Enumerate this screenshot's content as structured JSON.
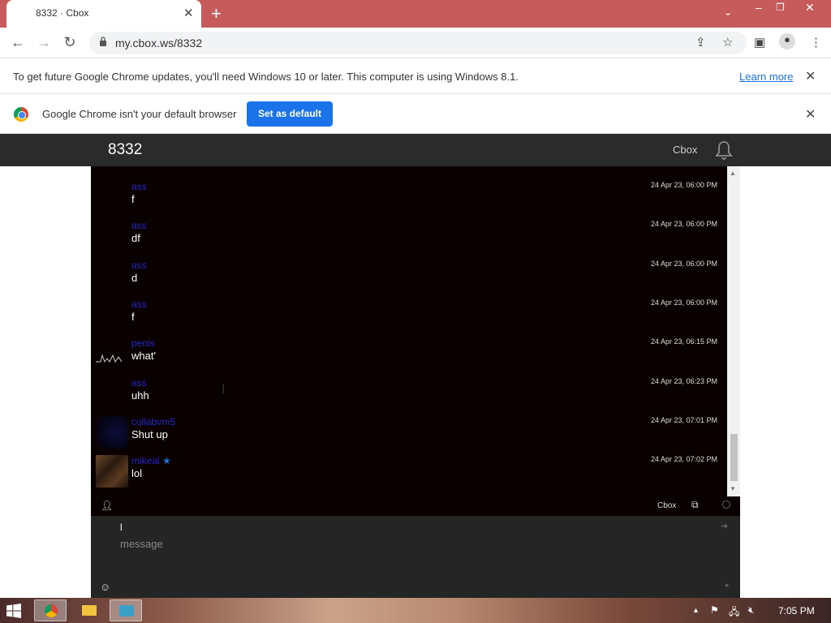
{
  "browser": {
    "tab_title": "8332 · Cbox",
    "url": "my.cbox.ws/8332",
    "update_message": "To get future Google Chrome updates, you'll need Windows 10 or later. This computer is using Windows 8.1.",
    "learn_more": "Learn more",
    "default_message": "Google Chrome isn't your default browser",
    "set_default_label": "Set as default"
  },
  "header": {
    "room_title": "8332",
    "cbox_link": "Cbox"
  },
  "messages": [
    {
      "name": "ass",
      "text": "f",
      "time": "24 Apr 23, 06:00 PM",
      "avatar": "none"
    },
    {
      "name": "ass",
      "text": "df",
      "time": "24 Apr 23, 06:00 PM",
      "avatar": "none"
    },
    {
      "name": "ass",
      "text": "d",
      "time": "24 Apr 23, 06:00 PM",
      "avatar": "none"
    },
    {
      "name": "ass",
      "text": "f",
      "time": "24 Apr 23, 06:00 PM",
      "avatar": "none"
    },
    {
      "name": "penis",
      "text": "what'",
      "time": "24 Apr 23, 06:15 PM",
      "avatar": "squiggle"
    },
    {
      "name": "ass",
      "text": "uhh",
      "time": "24 Apr 23, 06:23 PM",
      "avatar": "none"
    },
    {
      "name": "collabvm5",
      "text": "Shut up",
      "time": "24 Apr 23, 07:01 PM",
      "avatar": "dark"
    },
    {
      "name": "mikeal",
      "text": "lol",
      "time": "24 Apr 23, 07:02 PM",
      "avatar": "photo"
    }
  ],
  "chatbar": {
    "cbox_label": "Cbox"
  },
  "input": {
    "name_value": "l",
    "message_placeholder": "message"
  },
  "taskbar": {
    "clock": "7:05 PM"
  },
  "colors": {
    "accent": "#1a73e8",
    "chat_background": "#0a0000",
    "username": "#2525c8"
  }
}
